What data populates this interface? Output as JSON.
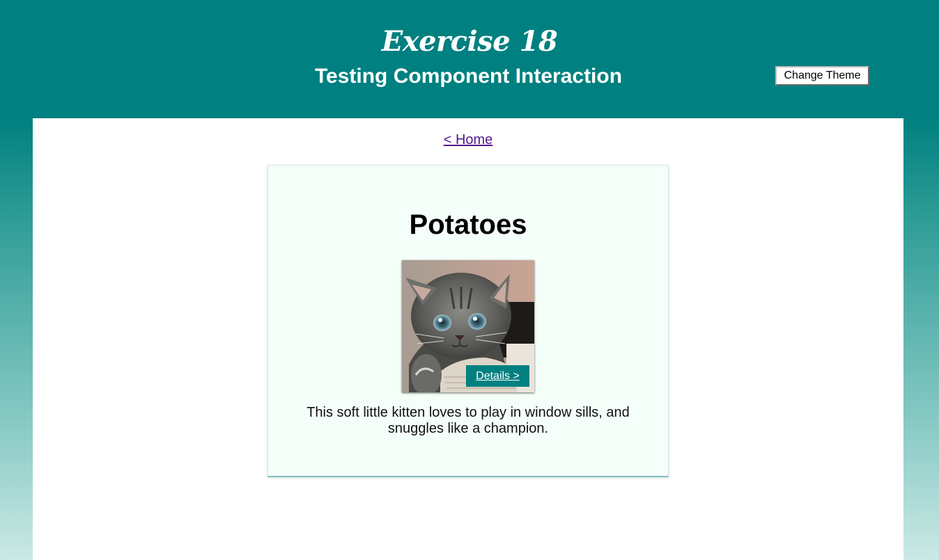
{
  "header": {
    "title": "Exercise 18",
    "subtitle": "Testing Component Interaction",
    "theme_button_label": "Change Theme"
  },
  "nav": {
    "home_link_label": "< Home"
  },
  "card": {
    "title": "Potatoes",
    "image_icon": "kitten-photo",
    "details_label": "Details >",
    "description": "This soft little kitten loves to play in window sills, and snuggles like a champion."
  },
  "colors": {
    "header_bg": "#008080",
    "card_bg": "#f5fff9",
    "details_button_bg": "#008080",
    "link": "#551a8b"
  }
}
